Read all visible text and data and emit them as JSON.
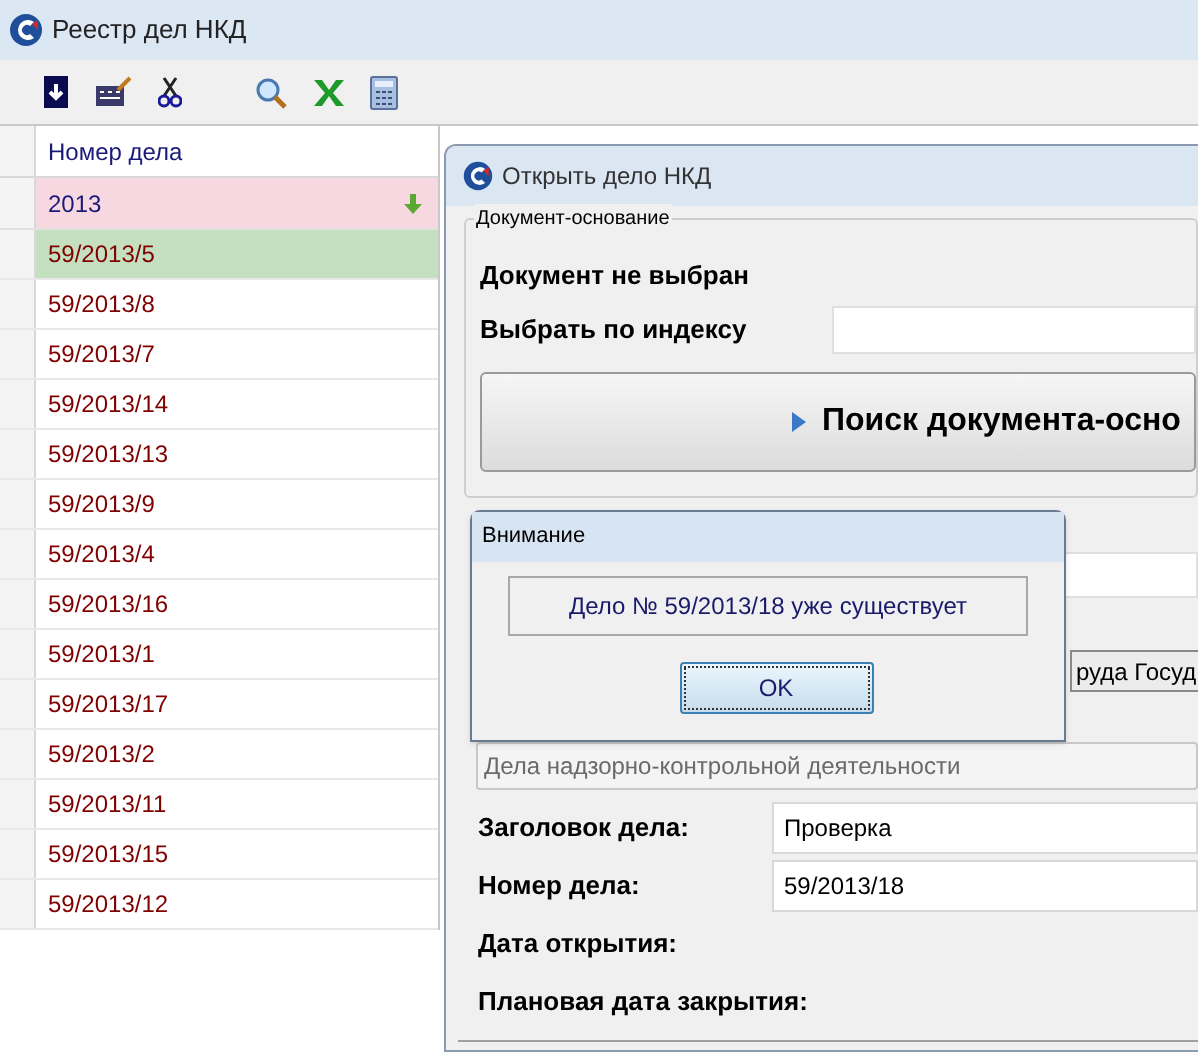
{
  "window": {
    "title": "Реестр дел НКД"
  },
  "grid": {
    "column": "Номер дела",
    "group": "2013",
    "rows": [
      {
        "number": "59/2013/5",
        "selected": true
      },
      {
        "number": "59/2013/8",
        "selected": false
      },
      {
        "number": "59/2013/7",
        "selected": false
      },
      {
        "number": "59/2013/14",
        "selected": false
      },
      {
        "number": "59/2013/13",
        "selected": false
      },
      {
        "number": "59/2013/9",
        "selected": false
      },
      {
        "number": "59/2013/4",
        "selected": false
      },
      {
        "number": "59/2013/16",
        "selected": false
      },
      {
        "number": "59/2013/1",
        "selected": false
      },
      {
        "number": "59/2013/17",
        "selected": false
      },
      {
        "number": "59/2013/2",
        "selected": false
      },
      {
        "number": "59/2013/11",
        "selected": false
      },
      {
        "number": "59/2013/15",
        "selected": false
      },
      {
        "number": "59/2013/12",
        "selected": false
      }
    ]
  },
  "dialog": {
    "title": "Открыть дело НКД",
    "group_title": "Документ-основание",
    "document_status": "Документ не выбран",
    "index_label": "Выбрать по индексу",
    "search_button": "Поиск документа-осно",
    "partial_button": "руда Госуд",
    "category": "Дела надзорно-контрольной деятельности",
    "fields": [
      {
        "kind": "input",
        "label": "Заголовок дела:",
        "value": "Проверка"
      },
      {
        "kind": "input",
        "label": "Номер дела:",
        "value": "59/2013/18"
      },
      {
        "kind": "label",
        "label": "Дата открытия:"
      },
      {
        "kind": "label",
        "label": "Плановая дата закрытия:"
      }
    ]
  },
  "alert": {
    "title": "Внимание",
    "message": "Дело № 59/2013/18 уже существует",
    "button": "OK"
  }
}
